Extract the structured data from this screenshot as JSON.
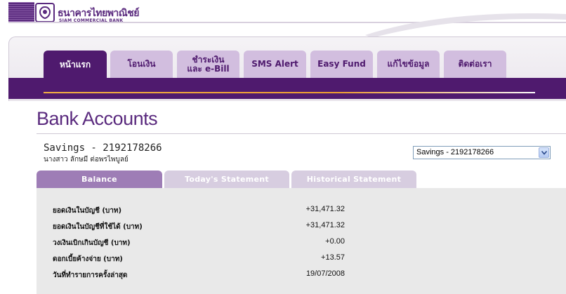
{
  "header": {
    "bank_name_th": "ธนาคารไทยพาณิชย์",
    "bank_name_en": "SIAM COMMERCIAL BANK",
    "brand_color": "#5a2a7e"
  },
  "nav": {
    "tabs": [
      {
        "label": "หน้าแรก",
        "active": true
      },
      {
        "label": "โอนเงิน",
        "active": false
      },
      {
        "label": "ชำระเงิน\nและ e-Bill",
        "active": false
      },
      {
        "label": "SMS Alert",
        "active": false
      },
      {
        "label": "Easy Fund",
        "active": false
      },
      {
        "label": "แก้ไขข้อมูล",
        "active": false
      },
      {
        "label": "ติดต่อเรา",
        "active": false
      }
    ]
  },
  "page": {
    "title": "Bank Accounts"
  },
  "account": {
    "number_label": "Savings - 2192178266",
    "holder_name": "นางสาว ลักษมี ต่อพรไพบูลย์",
    "selector_value": "Savings - 2192178266"
  },
  "subtabs": [
    {
      "label": "Balance",
      "active": true
    },
    {
      "label": "Today's Statement",
      "active": false
    },
    {
      "label": "Historical Statement",
      "active": false
    }
  ],
  "balance_rows": [
    {
      "label": "ยอดเงินในบัญชี (บาท)",
      "value": "+31,471.32"
    },
    {
      "label": "ยอดเงินในบัญชีที่ใช้ได้ (บาท)",
      "value": "+31,471.32"
    },
    {
      "label": "วงเงินเบิกเกินบัญชี (บาท)",
      "value": "+0.00"
    },
    {
      "label": "ดอกเบี้ยค้างจ่าย (บาท)",
      "value": "+13.57"
    },
    {
      "label": "วันที่ทำรายการครั้งล่าสุด",
      "value": "19/07/2008"
    }
  ]
}
